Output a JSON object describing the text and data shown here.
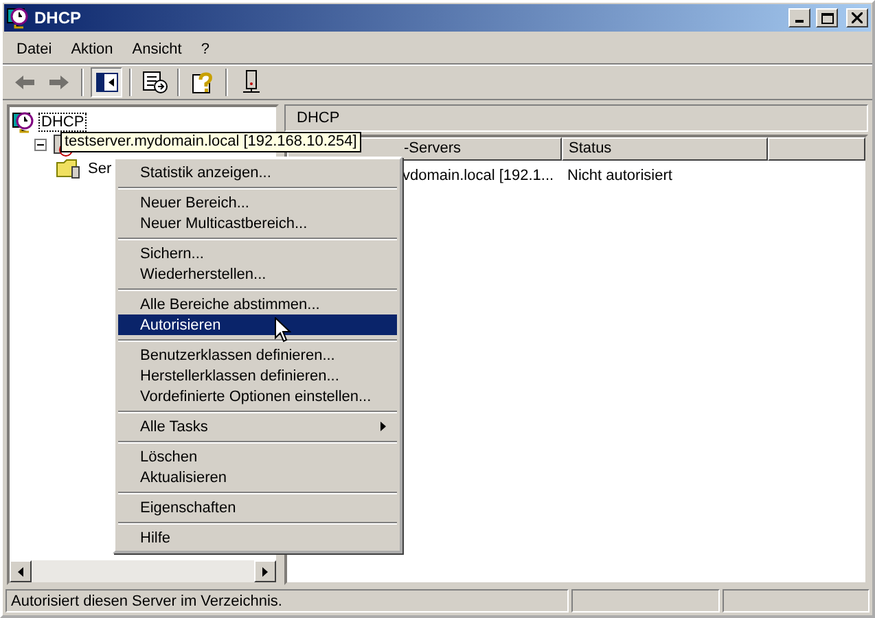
{
  "window": {
    "title": "DHCP"
  },
  "menu_bar": [
    {
      "label": "Datei"
    },
    {
      "label": "Aktion"
    },
    {
      "label": "Ansicht"
    },
    {
      "label": "?"
    }
  ],
  "toolbar": [
    {
      "kind": "back",
      "disabled": true,
      "pressed": false
    },
    {
      "kind": "forward",
      "disabled": true,
      "pressed": false
    },
    {
      "kind": "separator"
    },
    {
      "kind": "tree-toggle",
      "disabled": false,
      "pressed": true
    },
    {
      "kind": "separator"
    },
    {
      "kind": "export",
      "disabled": false,
      "pressed": false
    },
    {
      "kind": "separator"
    },
    {
      "kind": "help",
      "disabled": false,
      "pressed": false
    },
    {
      "kind": "separator"
    },
    {
      "kind": "server",
      "disabled": false,
      "pressed": false
    }
  ],
  "tree": [
    {
      "label": "DHCP",
      "selected": true,
      "children": [
        {
          "tooltip": "testserver.mydomain.local [192.168.10.254]",
          "expanded": true,
          "children": [
            {
              "label": "Ser",
              "selected": false
            }
          ]
        }
      ]
    }
  ],
  "details": {
    "title": "DHCP",
    "columns": [
      {
        "label": "-Servers"
      },
      {
        "label": "Status"
      }
    ],
    "rows": [
      [
        "vdomain.local [192.1...",
        "Nicht autorisiert"
      ]
    ]
  },
  "context_menu": [
    {
      "kind": "item",
      "label": "Statistik anzeigen...",
      "selected": false
    },
    {
      "kind": "separator"
    },
    {
      "kind": "item",
      "label": "Neuer Bereich...",
      "selected": false
    },
    {
      "kind": "item",
      "label": "Neuer Multicastbereich...",
      "selected": false
    },
    {
      "kind": "separator"
    },
    {
      "kind": "item",
      "label": "Sichern...",
      "selected": false
    },
    {
      "kind": "item",
      "label": "Wiederherstellen...",
      "selected": false
    },
    {
      "kind": "separator"
    },
    {
      "kind": "item",
      "label": "Alle Bereiche abstimmen...",
      "selected": false
    },
    {
      "kind": "item",
      "label": "Autorisieren",
      "selected": true
    },
    {
      "kind": "separator"
    },
    {
      "kind": "item",
      "label": "Benutzerklassen definieren...",
      "selected": false
    },
    {
      "kind": "item",
      "label": "Herstellerklassen definieren...",
      "selected": false
    },
    {
      "kind": "item",
      "label": "Vordefinierte Optionen einstellen...",
      "selected": false
    },
    {
      "kind": "separator"
    },
    {
      "kind": "submenu",
      "label": "Alle Tasks",
      "selected": false
    },
    {
      "kind": "separator"
    },
    {
      "kind": "item",
      "label": "Löschen",
      "selected": false
    },
    {
      "kind": "item",
      "label": "Aktualisieren",
      "selected": false
    },
    {
      "kind": "separator"
    },
    {
      "kind": "item",
      "label": "Eigenschaften",
      "selected": false
    },
    {
      "kind": "separator"
    },
    {
      "kind": "item",
      "label": "Hilfe",
      "selected": false
    }
  ],
  "status_bar": {
    "text": "Autorisiert diesen Server im Verzeichnis."
  }
}
